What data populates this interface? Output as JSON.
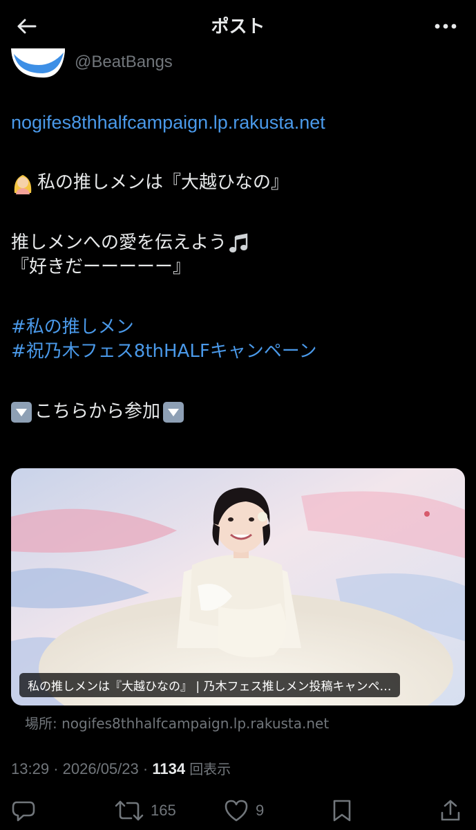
{
  "header": {
    "title": "ポスト"
  },
  "author": {
    "handle": "@BeatBangs"
  },
  "post": {
    "link": "nogifes8thhalfcampaign.lp.rakusta.net",
    "line_oshi": "私の推しメンは『大越ひなの』",
    "line_love": "推しメンへの愛を伝えよう",
    "line_suki": "『好きだーーーーー』",
    "hashtags": [
      "#私の推しメン",
      "#祝乃木フェス8thHALFキャンペーン"
    ],
    "line_join": "こちらから参加"
  },
  "card": {
    "caption": "私の推しメンは『大越ひなの』 | 乃木フェス推しメン投稿キャンペ…",
    "source": "場所: nogifes8thhalfcampaign.lp.rakusta.net"
  },
  "meta": {
    "time": "13:29",
    "separator": "·",
    "date": "2026/05/23",
    "views_count": "1134",
    "views_label": "回表示"
  },
  "actions": {
    "reply_count": "",
    "repost_count": "165",
    "like_count": "9"
  },
  "colors": {
    "background": "#000000",
    "text": "#e7e9ea",
    "secondary": "#71767b",
    "link": "#4a99e9"
  }
}
